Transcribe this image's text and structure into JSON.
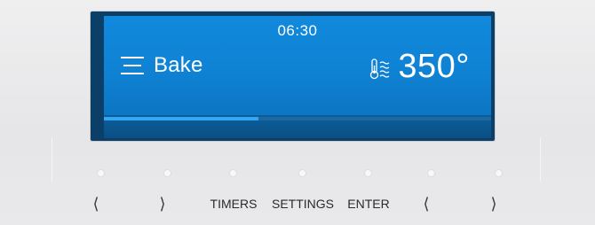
{
  "display": {
    "time": "06:30",
    "mode_label": "Bake",
    "temperature": "350°",
    "progress_percent": 40
  },
  "controls": {
    "left_back_label": "⟨",
    "left_forward_label": "⟩",
    "timers_label": "TIMERS",
    "settings_label": "SETTINGS",
    "enter_label": "ENTER",
    "right_back_label": "⟨",
    "right_forward_label": "⟩"
  },
  "icons": {
    "mode": "menu-lines-icon",
    "temperature": "thermometer-heat-icon"
  },
  "colors": {
    "screen_blue": "#1189dc",
    "screen_dark": "#0a4f84",
    "progress": "#35a7f2",
    "panel": "#ebebec",
    "text_dark": "#2a2a2d"
  }
}
